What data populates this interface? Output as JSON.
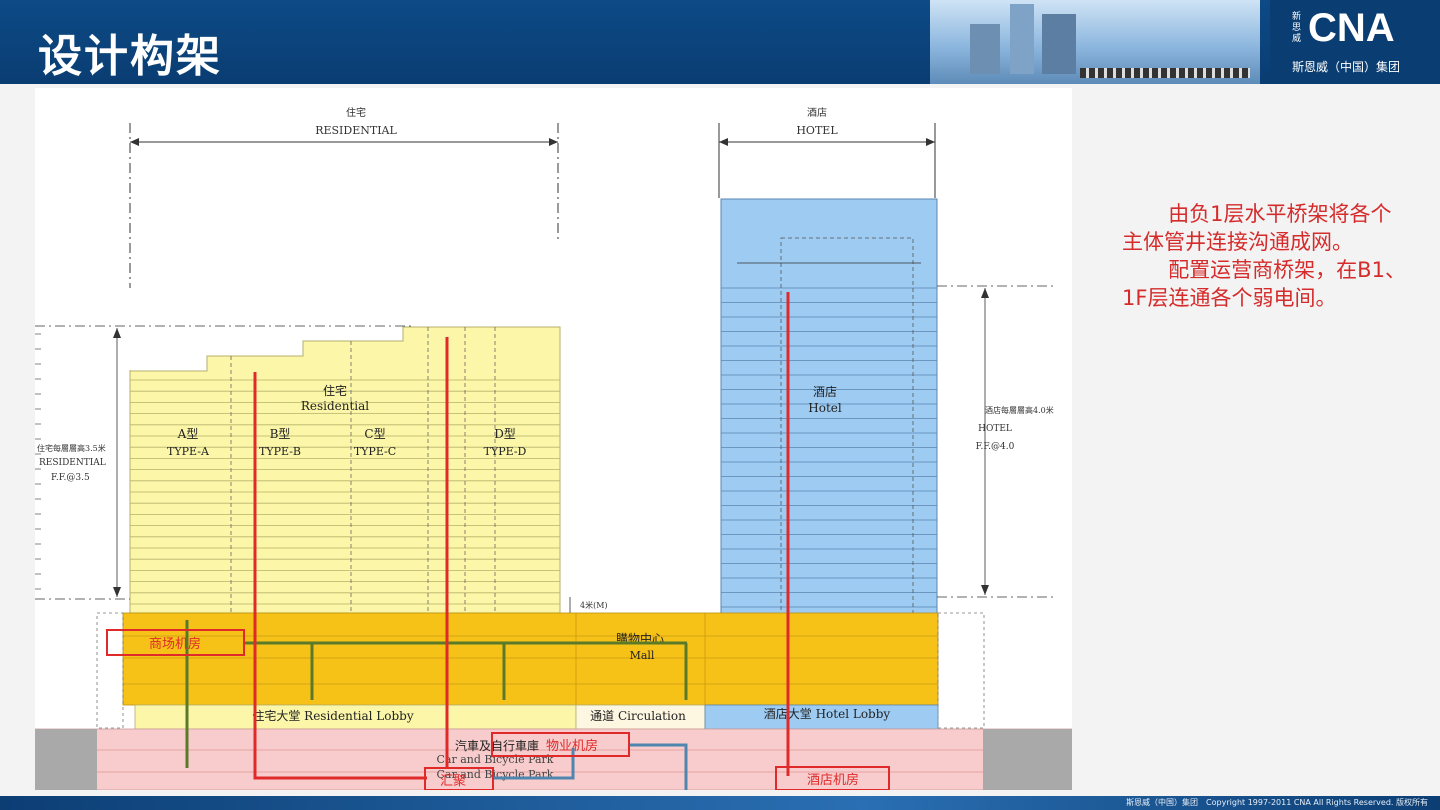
{
  "header": {
    "title": "设计构架",
    "logo": {
      "brand": "CNA",
      "mark": "新思威",
      "subtitle": "斯恩威（中国）集团"
    }
  },
  "diagram": {
    "dim_residential": {
      "cn": "住宅",
      "en": "RESIDENTIAL"
    },
    "dim_hotel": {
      "cn": "酒店",
      "en": "HOTEL"
    },
    "residential_block": {
      "cn": "住宅",
      "en": "Residential"
    },
    "types": [
      {
        "cn": "A型",
        "en": "TYPE-A"
      },
      {
        "cn": "B型",
        "en": "TYPE-B"
      },
      {
        "cn": "C型",
        "en": "TYPE-C"
      },
      {
        "cn": "D型",
        "en": "TYPE-D"
      }
    ],
    "hotel_block": {
      "cn": "酒店",
      "en": "Hotel"
    },
    "left_note": {
      "line1": "住宅每層層高3.5米",
      "line2": "RESIDENTIAL",
      "line3": "F.F.@3.5"
    },
    "right_note": {
      "line1": "酒店每層層高4.0米",
      "line2": "HOTEL",
      "line3": "F.F.@4.0"
    },
    "gap_label": "4米(M)",
    "mall": {
      "cn": "購物中心",
      "en": "Mall"
    },
    "res_lobby": "住宅大堂 Residential Lobby",
    "circulation": "通道 Circulation",
    "hotel_lobby": "酒店大堂 Hotel Lobby",
    "parking": {
      "cn": "汽車及自行車庫",
      "en": "Car and Bicycle Park",
      "en2": "Car and Bicycle Park"
    },
    "rooms": {
      "mall_room": "商场机房",
      "property_room": "物业机房",
      "convergence": "汇聚",
      "hotel_room": "酒店机房"
    }
  },
  "note": {
    "p1": "由负1层水平桥架将各个主体管井连接沟通成网。",
    "p2": "配置运营商桥架，在B1、1F层连通各个弱电间。"
  },
  "footer": {
    "copyright": "斯恩威（中国）集团　Copyright 1997-2011 CNA All Rights Reserved. 版权所有"
  },
  "colors": {
    "red": "#e02a2a",
    "green": "#5a7a2a",
    "blue": "#4f86b0",
    "mall": "#f6c218",
    "yellow": "#fbf6a8",
    "hotel": "#9ecbf2",
    "parking": "#f8cccc"
  }
}
